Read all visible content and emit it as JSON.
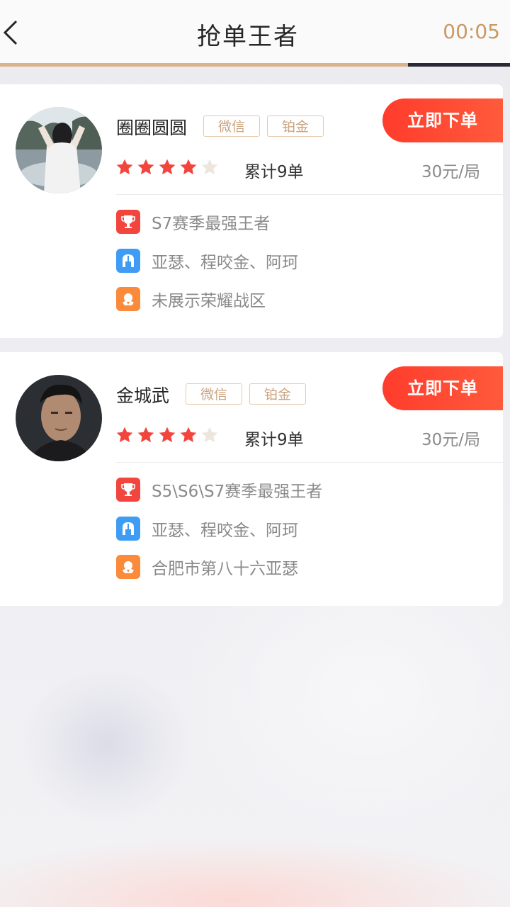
{
  "header": {
    "title": "抢单王者",
    "timer": "00:05",
    "progress": 0.8
  },
  "cards": [
    {
      "name": "圈圈圆圆",
      "tags": [
        "微信",
        "铂金"
      ],
      "order_label": "立即下单",
      "rating": 4,
      "rating_max": 5,
      "count": "累计9单",
      "price": "30元/局",
      "info": [
        {
          "icon": "trophy-icon",
          "text": "S7赛季最强王者"
        },
        {
          "icon": "helmet-icon",
          "text": "亚瑟、程咬金、阿珂"
        },
        {
          "icon": "badge-icon",
          "text": "未展示荣耀战区"
        }
      ]
    },
    {
      "name": "金城武",
      "tags": [
        "微信",
        "铂金"
      ],
      "order_label": "立即下单",
      "rating": 4,
      "rating_max": 5,
      "count": "累计9单",
      "price": "30元/局",
      "info": [
        {
          "icon": "trophy-icon",
          "text": "S5\\S6\\S7赛季最强王者"
        },
        {
          "icon": "helmet-icon",
          "text": "亚瑟、程咬金、阿珂"
        },
        {
          "icon": "badge-icon",
          "text": "合肥市第八十六亚瑟"
        }
      ]
    }
  ],
  "colors": {
    "accent": "#ff3c2c",
    "timer": "#c89a62",
    "star_on": "#f2453d",
    "star_off": "#ede6dd"
  }
}
